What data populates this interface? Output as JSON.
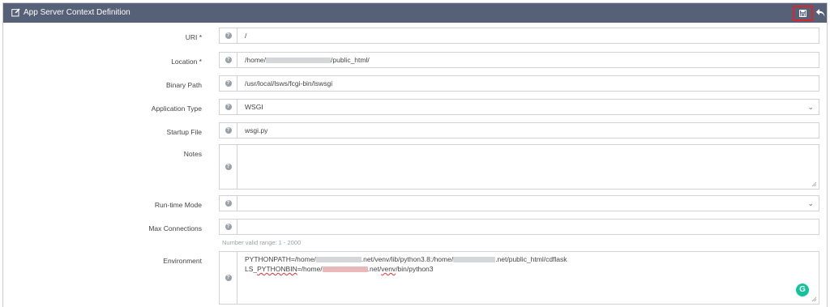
{
  "header": {
    "title": "App Server Context Definition",
    "edit_icon": "edit-icon",
    "save_icon": "floppy-disk-icon",
    "back_icon": "undo-arrow-icon",
    "accent_color": "#566076",
    "highlight_color": "#d9262b"
  },
  "form": {
    "uri": {
      "label": "URI *",
      "value": "/"
    },
    "location": {
      "label": "Location *",
      "value_prefix": "/home/",
      "value_suffix": "/public_html/"
    },
    "binary_path": {
      "label": "Binary Path",
      "value": "/usr/local/lsws/fcgi-bin/lswsgi"
    },
    "application_type": {
      "label": "Application Type",
      "value": "WSGI"
    },
    "startup_file": {
      "label": "Startup File",
      "value": "wsgi.py"
    },
    "notes": {
      "label": "Notes",
      "value": ""
    },
    "runtime_mode": {
      "label": "Run-time Mode",
      "value": ""
    },
    "max_connections": {
      "label": "Max Connections",
      "value": "",
      "hint": "Number valid range: 1 - 2000"
    },
    "environment": {
      "label": "Environment",
      "line1_a": "PYTHONPATH=/home/",
      "line1_b": ".net/venv/lib/python3.8:/home/",
      "line1_c": ".net/public_html/cdflask",
      "line2_a": "LS_",
      "line2_b": "PYTHONBIN",
      "line2_c": "=/home/",
      "line2_d": ".net/",
      "line2_e": "venv",
      "line2_f": "/bin/python3"
    }
  },
  "help_icon": "question-circle-icon",
  "grammarly_icon": "grammarly-icon"
}
